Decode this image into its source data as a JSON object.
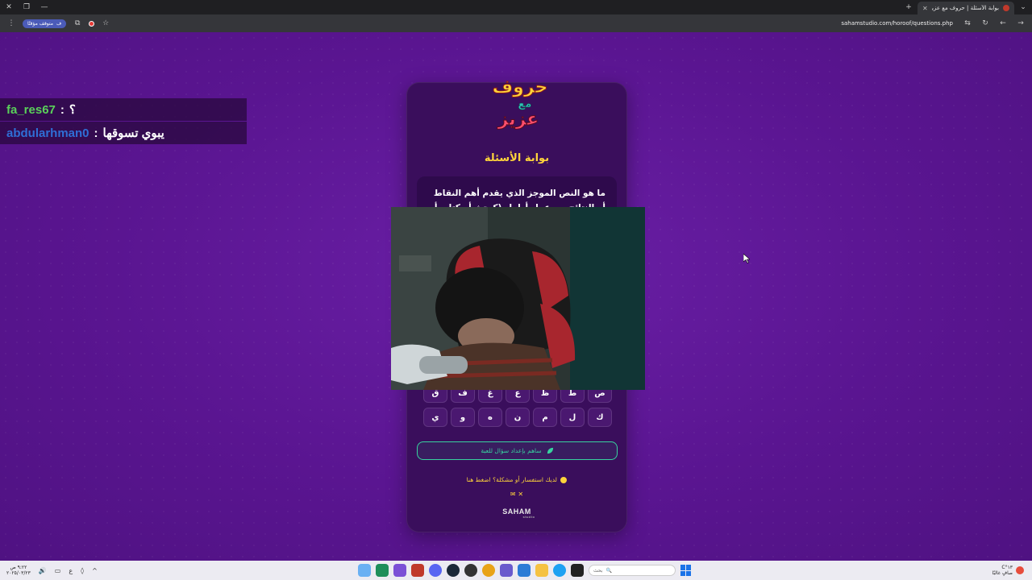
{
  "browser": {
    "tab_title": "بوابة الأسئلة | حروف مع عزيز",
    "url": "sahamstudio.com/horoof/questions.php",
    "paused_label": "متوقف مؤقتًا",
    "profile_initial": "ف"
  },
  "chat": [
    {
      "user": "fa_res67",
      "message": "؟",
      "user_color": "#5ad15a"
    },
    {
      "user": "abdularhman0",
      "message": "يبوي تسوقها",
      "user_color": "#2f6fd6"
    }
  ],
  "card": {
    "logo_text": "حروف مع عزيز",
    "title": "بوابة الأسئلة",
    "question": "ما هو النص الموجز الذي يقدم أهم النقاط أو النتائج من عمل أطول (كبحث أو كتاب أو",
    "letters_row1": [
      "ص",
      "ط",
      "ظ",
      "ع",
      "غ",
      "ف",
      "ق"
    ],
    "letters_row2": [
      "ك",
      "ل",
      "م",
      "ن",
      "ه",
      "و",
      "ي"
    ],
    "contribute_label": "ساهم بإعداد سؤال للعبة",
    "inquiry_label": "لديك استفسار أو مشكلة؟ اضغط هنا",
    "brand": "SAHAM",
    "brand_sub": "studio"
  },
  "taskbar": {
    "time": "٩:٢٢ ص",
    "date": "٢٠٢٥/٠٣/٢٣",
    "search_placeholder": "بحث",
    "weather_temp": "١٣°C",
    "weather_desc": "صافٍ غالبًا",
    "lang": "ع"
  },
  "colors": {
    "accent_yellow": "#ffd43b",
    "accent_green": "#38d39f",
    "page_purple": "#5c1790",
    "card_purple": "#3a0e5c"
  }
}
